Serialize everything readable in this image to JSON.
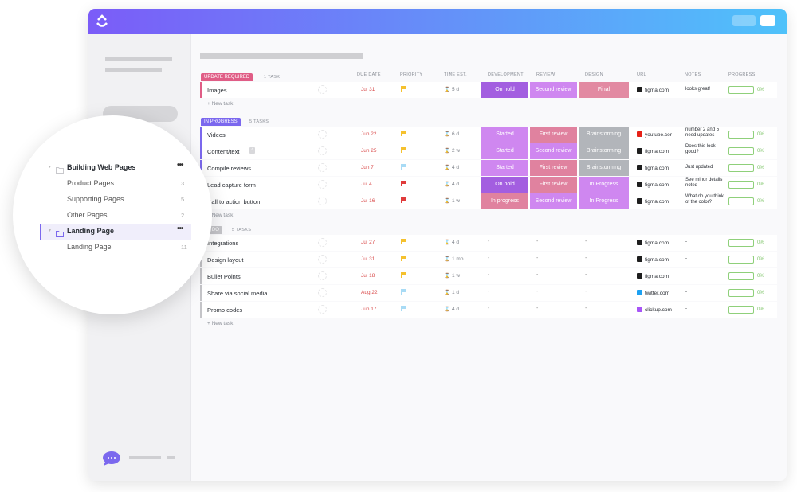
{
  "colors": {
    "header_start": "#7b5cf8",
    "header_end": "#4fc2fa",
    "accent": "#7b68ee"
  },
  "columns": {
    "due": "DUE DATE",
    "priority": "PRIORITY",
    "time": "TIME EST.",
    "dev": "DEVELOPMENT",
    "review": "REVIEW",
    "design": "DESIGN",
    "url": "URL",
    "notes": "NOTES",
    "progress": "PROGRESS"
  },
  "new_task": "+ New task",
  "groups": [
    {
      "status": "UPDATE REQUIRED",
      "color": "#e05d86",
      "count": "1 TASK",
      "tasks": [
        {
          "name": "Images",
          "due": "Jul 31",
          "priority": "yellow",
          "time": "5 d",
          "dev": "On hold",
          "review": "Second review",
          "design": "Final",
          "url": "figma.com",
          "url_icon": "figma-icon",
          "notes": "looks great!",
          "progress": "0%"
        }
      ]
    },
    {
      "status": "IN PROGRESS",
      "color": "#7b68ee",
      "count": "5 TASKS",
      "tasks": [
        {
          "name": "Videos",
          "due": "Jun 22",
          "priority": "yellow",
          "time": "6 d",
          "dev": "Started",
          "review": "First review",
          "design": "Brainstorming",
          "url": "youtube.cor",
          "url_icon": "youtube-icon",
          "notes": "number 2 and 5 need updates",
          "progress": "0%"
        },
        {
          "name": "Content/text",
          "subtasks": "4",
          "due": "Jun 25",
          "priority": "yellow",
          "time": "2 w",
          "dev": "Started",
          "review": "Second review",
          "design": "Brainstorming",
          "url": "figma.com",
          "url_icon": "figma-icon",
          "notes": "Does this look good?",
          "progress": "0%"
        },
        {
          "name": "Compile reviews",
          "due": "Jun 7",
          "priority": "lightblue",
          "time": "4 d",
          "dev": "Started",
          "review": "First review",
          "design": "Brainstorming",
          "url": "figma.com",
          "url_icon": "figma-icon",
          "notes": "Just updated",
          "progress": "0%"
        },
        {
          "name": "Lead capture form",
          "due": "Jul 4",
          "priority": "red",
          "time": "4 d",
          "dev": "On hold",
          "review": "First review",
          "design": "In Progress",
          "url": "figma.com",
          "url_icon": "figma-icon",
          "notes": "See minor details noted",
          "progress": "0%"
        },
        {
          "name": "Call to action button",
          "due": "Jul 16",
          "priority": "red",
          "time": "1 w",
          "dev": "In progress",
          "review": "Second review",
          "design": "In Progress",
          "url": "figma.com",
          "url_icon": "figma-icon",
          "notes": "What do you think of the color?",
          "progress": "0%"
        }
      ]
    },
    {
      "status": "TO DO",
      "color": "#c4c4c8",
      "count": "5 TASKS",
      "tasks": [
        {
          "name": "Integrations",
          "due": "Jul 27",
          "priority": "yellow",
          "time": "4 d",
          "dev": "-",
          "review": "-",
          "design": "-",
          "url": "figma.com",
          "url_icon": "figma-icon",
          "notes": "-",
          "progress": "0%"
        },
        {
          "name": "Design layout",
          "due": "Jul 31",
          "priority": "yellow",
          "time": "1 mo",
          "dev": "-",
          "review": "-",
          "design": "-",
          "url": "figma.com",
          "url_icon": "figma-icon",
          "notes": "-",
          "progress": "0%"
        },
        {
          "name": "Bullet Points",
          "due": "Jul 18",
          "priority": "yellow",
          "time": "1 w",
          "dev": "-",
          "review": "-",
          "design": "-",
          "url": "figma.com",
          "url_icon": "figma-icon",
          "notes": "-",
          "progress": "0%"
        },
        {
          "name": "Share via social media",
          "due": "Aug 22",
          "priority": "lightblue",
          "time": "1 d",
          "dev": "-",
          "review": "-",
          "design": "-",
          "url": "twitter.com",
          "url_icon": "twitter-icon",
          "notes": "-",
          "progress": "0%"
        },
        {
          "name": "Promo codes",
          "due": "Jun 17",
          "priority": "lightblue",
          "time": "4 d",
          "dev": "-",
          "review": "-",
          "design": "-",
          "url": "clickup.com",
          "url_icon": "clickup-icon",
          "notes": "-",
          "progress": "0%"
        }
      ]
    }
  ],
  "sidebar": {
    "folders": [
      {
        "name": "Building Web Pages",
        "lists": [
          {
            "name": "Product Pages",
            "count": "3"
          },
          {
            "name": "Supporting Pages",
            "count": "5"
          },
          {
            "name": "Other Pages",
            "count": "2"
          }
        ]
      },
      {
        "name": "Landing Page",
        "selected": true,
        "lists": [
          {
            "name": "Landing Page",
            "count": "11"
          }
        ]
      }
    ]
  }
}
